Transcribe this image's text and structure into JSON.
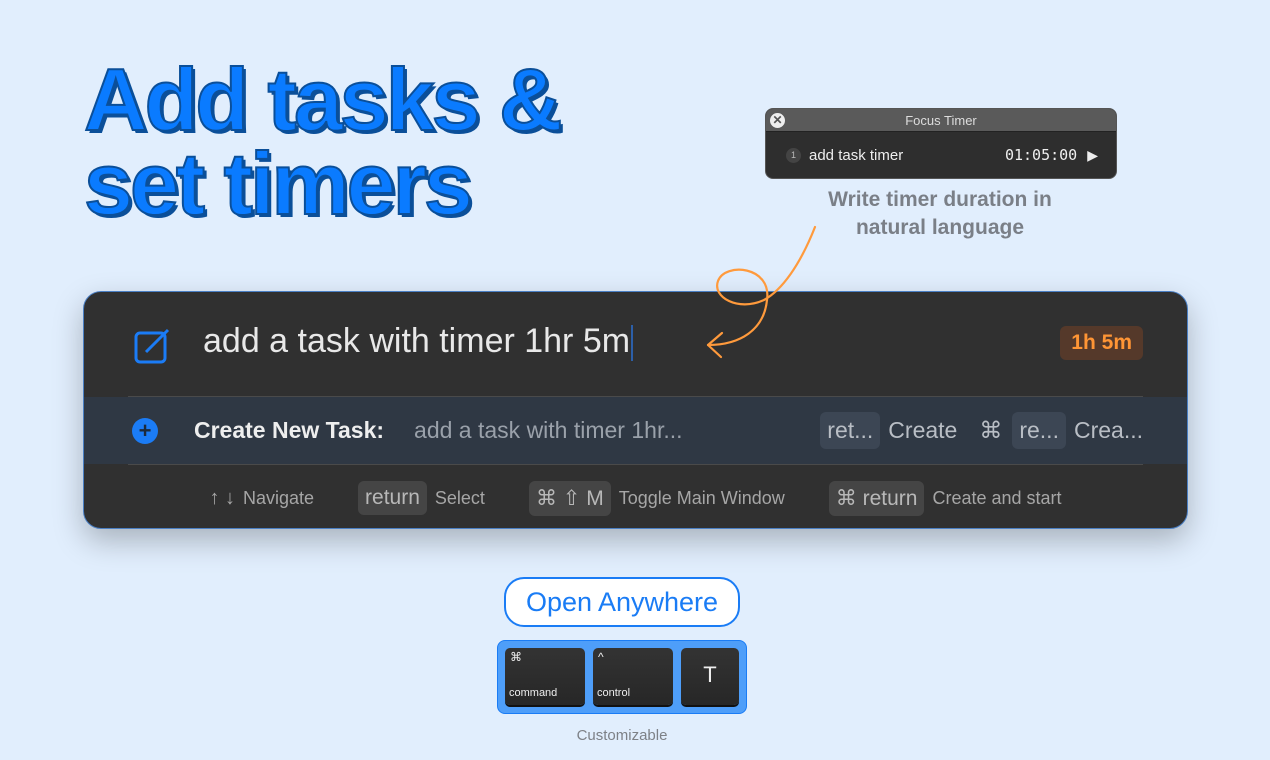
{
  "headline": {
    "line1": "Add tasks &",
    "line2": "set timers"
  },
  "focus_timer": {
    "title": "Focus Timer",
    "index": "1",
    "task": "add task timer",
    "time": "01:05:00"
  },
  "caption": {
    "line1": "Write timer duration in",
    "line2": "natural language"
  },
  "panel": {
    "query": "add a task with timer 1hr 5m",
    "duration_badge": "1h 5m",
    "result": {
      "label": "Create New Task:",
      "text": "add a task with timer 1hr...",
      "key1": "ret...",
      "action1": "Create",
      "cmd_symbol": "⌘",
      "key2": "re...",
      "action2": "Crea..."
    },
    "hints": [
      {
        "key": "",
        "arrows": "↑ ↓",
        "label": "Navigate"
      },
      {
        "key": "return",
        "label": "Select"
      },
      {
        "key": "⌘ ⇧ M",
        "label": "Toggle Main Window"
      },
      {
        "key": "⌘ return",
        "label": "Create and start"
      }
    ]
  },
  "open_button": "Open Anywhere",
  "shortcut_keys": [
    {
      "symbol": "⌘",
      "name": "command"
    },
    {
      "symbol": "^",
      "name": "control"
    },
    {
      "symbol": "T",
      "name": ""
    }
  ],
  "customizable": "Customizable",
  "colors": {
    "accent": "#0a7bff",
    "background": "#e1eefd",
    "panel": "#303030",
    "badge_text": "#ff9535",
    "arrow": "#ff9a3c"
  }
}
